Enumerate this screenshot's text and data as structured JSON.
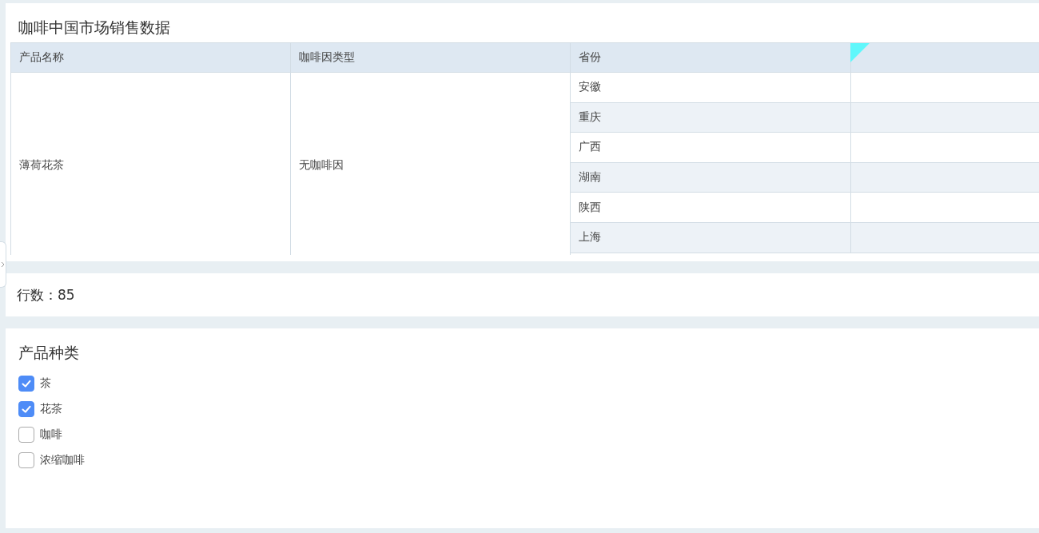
{
  "table_panel": {
    "title": "咖啡中国市场销售数据",
    "columns": [
      "产品名称",
      "咖啡因类型",
      "省份"
    ],
    "group": {
      "product": "薄荷花茶",
      "caffeine": "无咖啡因"
    },
    "provinces": [
      "安徽",
      "重庆",
      "广西",
      "湖南",
      "陕西",
      "上海"
    ]
  },
  "row_count": {
    "label": "行数：85"
  },
  "filter": {
    "title": "产品种类",
    "options": [
      {
        "label": "茶",
        "checked": true
      },
      {
        "label": "花茶",
        "checked": true
      },
      {
        "label": "咖啡",
        "checked": false
      },
      {
        "label": "浓缩咖啡",
        "checked": false
      }
    ]
  }
}
